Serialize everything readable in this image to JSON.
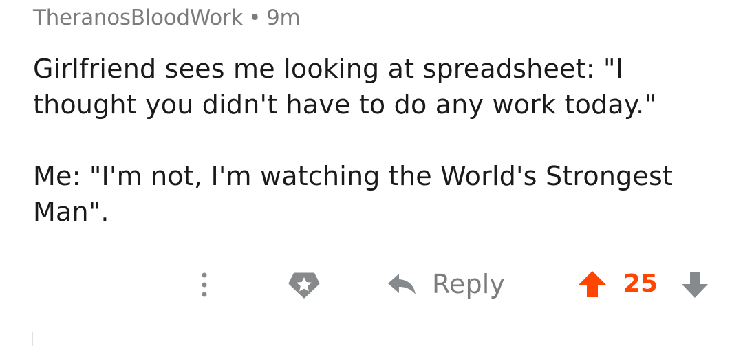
{
  "comment": {
    "author": "TheranosBloodWork",
    "separator": "•",
    "age": "9m",
    "paragraphs": [
      "Girlfriend sees me looking at spreadsheet: \"I thought you didn't have to do any work today.\"",
      "Me: \"I'm not, I'm watching the World's Strongest Man\"."
    ]
  },
  "actions": {
    "more_icon": "vertical-dots-icon",
    "award_icon": "award-star-icon",
    "reply_icon": "reply-arrow-icon",
    "reply_label": "Reply",
    "upvote_icon": "upvote-arrow-icon",
    "score": "25",
    "downvote_icon": "downvote-arrow-icon"
  },
  "colors": {
    "meta_text": "#7c7c7c",
    "body_text": "#1a1a1b",
    "upvoted": "#ff4500",
    "icon_gray": "#878a8c"
  }
}
